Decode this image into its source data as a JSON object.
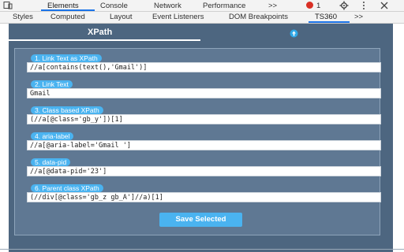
{
  "devtools": {
    "top_tabs": [
      "Elements",
      "Console",
      "Network",
      "Performance"
    ],
    "top_overflow": ">>",
    "error_count": "1",
    "subtabs": [
      "Styles",
      "Computed",
      "Layout",
      "Event Listeners",
      "DOM Breakpoints",
      "TS360"
    ],
    "sub_overflow": ">>"
  },
  "panel": {
    "tab_label": "XPath",
    "fields": [
      {
        "label": "1. Link Text as XPath",
        "value": "//a[contains(text(),'Gmail')]"
      },
      {
        "label": "2. Link Text",
        "value": "Gmail"
      },
      {
        "label": "3. Class based XPath",
        "value": "(//a[@class='gb_y'])[1]"
      },
      {
        "label": "4. aria-label",
        "value": "//a[@aria-label='Gmail ']"
      },
      {
        "label": "5. data-pid",
        "value": "//a[@data-pid='23']"
      },
      {
        "label": "6. Parent class XPath",
        "value": "(//div[@class='gb_z gb_A']//a)[1]"
      }
    ],
    "save_label": "Save Selected"
  }
}
